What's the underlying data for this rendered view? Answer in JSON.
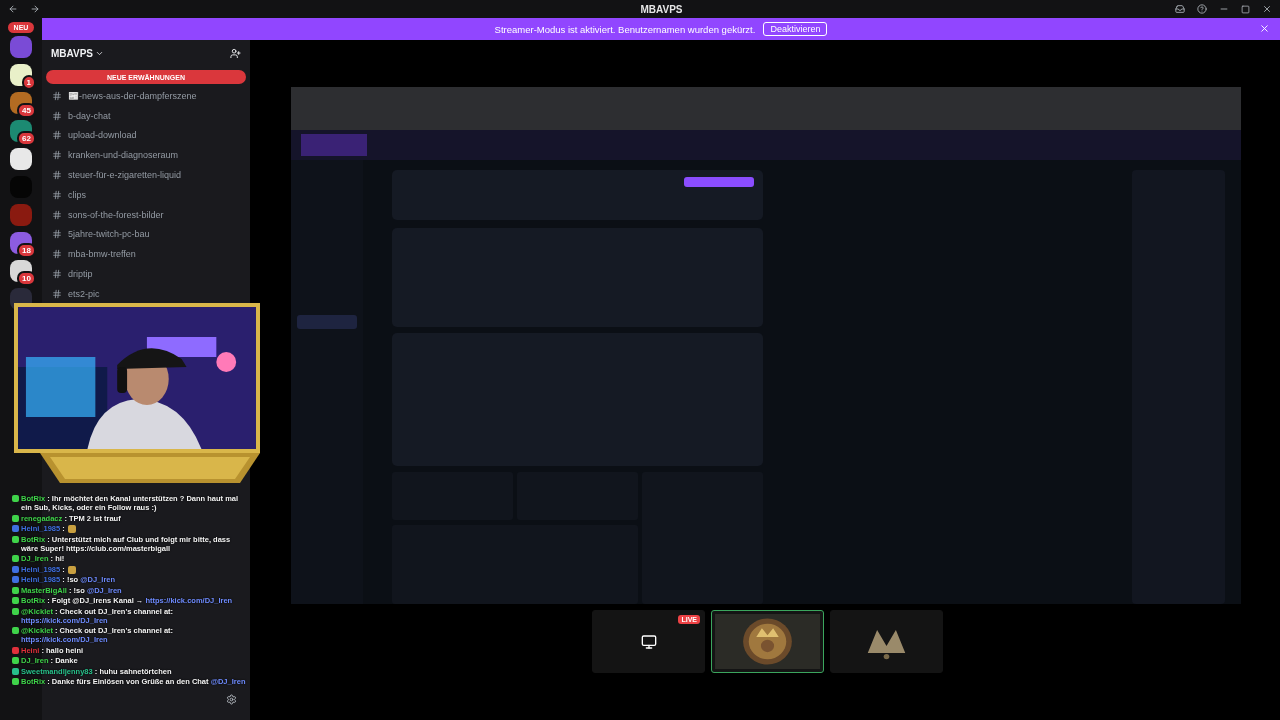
{
  "titlebar": {
    "title": "MBAVPS"
  },
  "servers": [
    {
      "badge": "NEU",
      "kind": "new"
    },
    {
      "badge": "1",
      "kind": "count"
    },
    {
      "badge": "45",
      "kind": "count"
    },
    {
      "badge": "62",
      "kind": "count"
    },
    {
      "kind": "plain"
    },
    {
      "kind": "plain"
    },
    {
      "kind": "plain"
    },
    {
      "badge": "18",
      "kind": "count"
    },
    {
      "badge": "10",
      "kind": "count"
    },
    {
      "kind": "plain"
    }
  ],
  "banner": {
    "text": "Streamer-Modus ist aktiviert. Benutzernamen wurden gekürzt.",
    "button": "Deaktivieren"
  },
  "sidebar": {
    "server_name": "MBAVPS",
    "mentions_pill": "NEUE ERWÄHNUNGEN",
    "channels": [
      {
        "name": "📰-news-aus-der-dampferszene"
      },
      {
        "name": "b-day-chat"
      },
      {
        "name": "upload-download"
      },
      {
        "name": "kranken-und-diagnoseraum"
      },
      {
        "name": "steuer-für-e-zigaretten-liquid"
      },
      {
        "name": "clips"
      },
      {
        "name": "sons-of-the-forest-bilder"
      },
      {
        "name": "5jahre-twitch-pc-bau"
      },
      {
        "name": "mba-bmw-treffen"
      },
      {
        "name": "driptip"
      },
      {
        "name": "ets2-pic"
      }
    ]
  },
  "chat_overlay": [
    {
      "user": "BotRix",
      "color": "#3fd34a",
      "text": ": Ihr möchtet den Kanal unterstützen ? Dann haut mal ein Sub, Kicks, oder ein Follow raus :)"
    },
    {
      "user": "renegadacz",
      "color": "#3fd34a",
      "text": ": TPM 2 ist trauf"
    },
    {
      "user": "Heini_1985",
      "color": "#3f6fe0",
      "text": ":",
      "emote": true
    },
    {
      "user": "BotRix",
      "color": "#3fd34a",
      "text": ": Unterstützt mich auf Club und folgt mir bitte, dass wäre Super! https://club.com/masterbigall"
    },
    {
      "user": "DJ_Iren",
      "color": "#3fd34a",
      "text": ": hi!"
    },
    {
      "user": "Heini_1985",
      "color": "#3f6fe0",
      "text": ":",
      "emote": true
    },
    {
      "user": "Heini_1985",
      "color": "#3f6fe0",
      "text": ": !so",
      "link": "@DJ_Iren"
    },
    {
      "user": "MasterBigAll",
      "color": "#3fd34a",
      "text": ": !so",
      "link": "@DJ_Iren"
    },
    {
      "user": "BotRix",
      "color": "#3fd34a",
      "text": ": Folgt @DJ_Irens Kanal →",
      "link": "https://kick.com/DJ_Iren"
    },
    {
      "user": "@Kicklet",
      "color": "#3fd34a",
      "text": ": Check out DJ_Iren's channel at:",
      "link": "https://kick.com/DJ_Iren"
    },
    {
      "user": "@Kicklet",
      "color": "#3fd34a",
      "text": ": Check out DJ_Iren's channel at:",
      "link": "https://kick.com/DJ_Iren"
    },
    {
      "user": "Heini",
      "color": "#e0313b",
      "text": ": hallo heini"
    },
    {
      "user": "DJ_Iren",
      "color": "#3fd34a",
      "text": ": Danke"
    },
    {
      "user": "Sweetmandljenny83",
      "color": "#27c08a",
      "text": ": huhu sahnetörtchen"
    },
    {
      "user": "BotRix",
      "color": "#3fd34a",
      "text": ": Danke fürs Einlösen von Grüße an den Chat",
      "link": "@DJ_Iren"
    }
  ],
  "thumbnails": [
    {
      "kind": "screen",
      "live": "LIVE",
      "selected": false
    },
    {
      "kind": "avatar",
      "selected": true
    },
    {
      "kind": "logo",
      "selected": false
    }
  ]
}
